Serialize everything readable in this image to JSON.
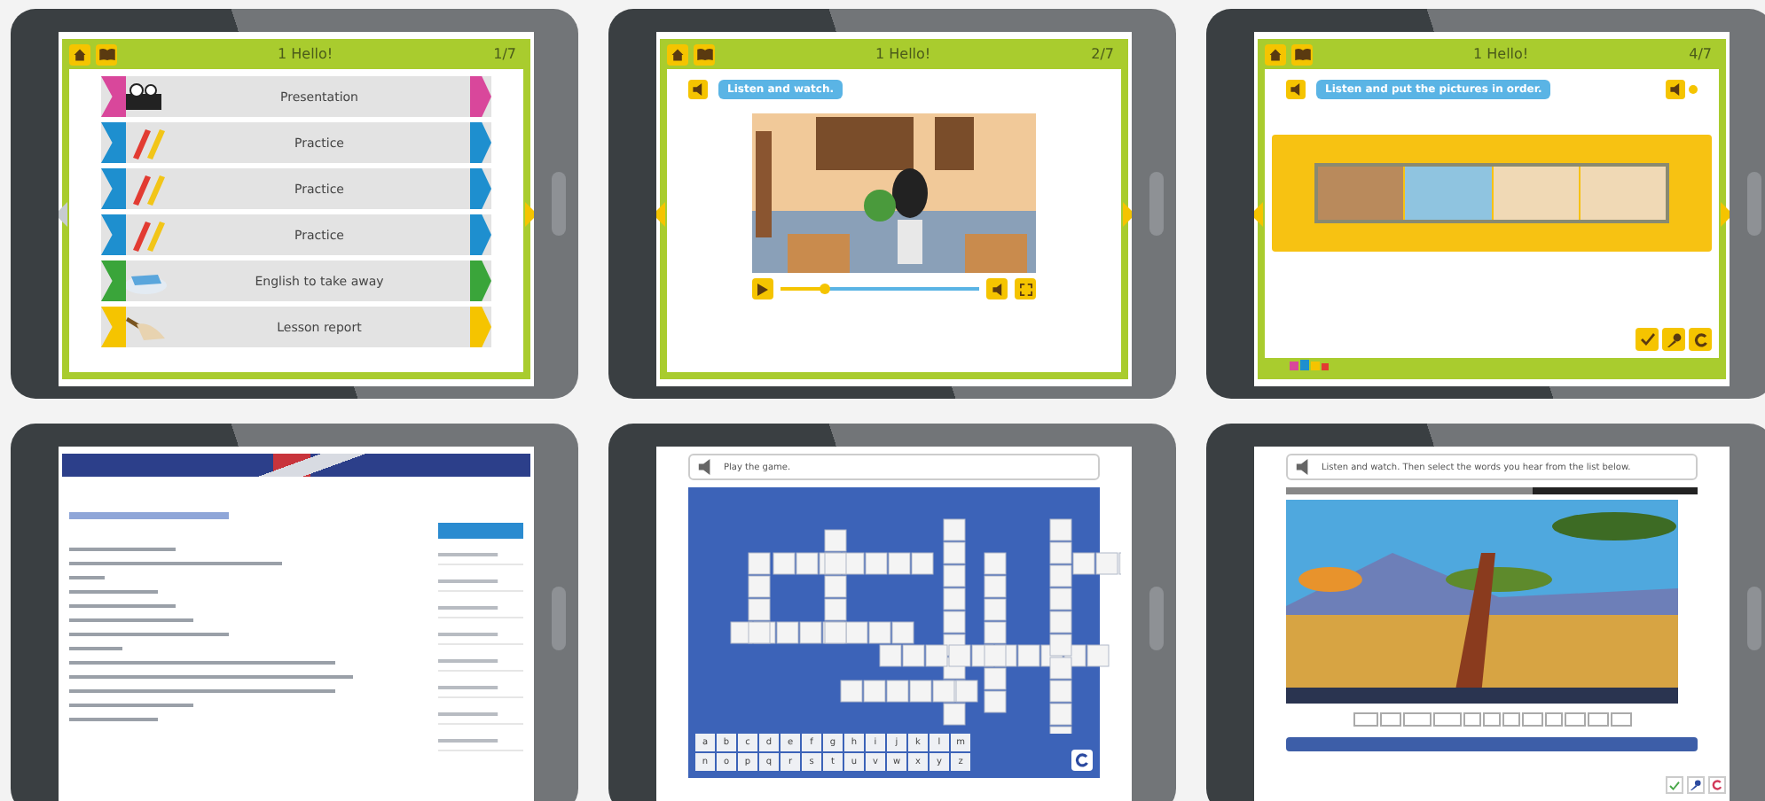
{
  "tablets": [
    {
      "kind": "menu",
      "header": {
        "title": "1 Hello!",
        "page": "1/7"
      },
      "prev_disabled": true,
      "items": [
        {
          "label": "Presentation",
          "kind": "presentation",
          "color": "#d9479b"
        },
        {
          "label": "Practice",
          "kind": "practice",
          "color": "#1e8fcf"
        },
        {
          "label": "Practice",
          "kind": "practice",
          "color": "#1e8fcf"
        },
        {
          "label": "Practice",
          "kind": "practice",
          "color": "#1e8fcf"
        },
        {
          "label": "English to take away",
          "kind": "takeaway",
          "color": "#3aa53a"
        },
        {
          "label": "Lesson report",
          "kind": "report",
          "color": "#f5c400"
        }
      ]
    },
    {
      "kind": "video",
      "header": {
        "title": "1 Hello!",
        "page": "2/7"
      },
      "prev_disabled": false,
      "instruction": "Listen and watch.",
      "player": {
        "level": 0.22
      }
    },
    {
      "kind": "ordering",
      "header": {
        "title": "1 Hello!",
        "page": "4/7"
      },
      "prev_disabled": false,
      "instruction": "Listen and put the pictures in order.",
      "pictures": [
        {
          "kind": "door"
        },
        {
          "kind": "window"
        },
        {
          "kind": "desk"
        },
        {
          "kind": "desk"
        }
      ]
    },
    {
      "kind": "webpage"
    },
    {
      "kind": "crossword",
      "instruction": "Play the game.",
      "keyboard": [
        [
          "a",
          "b",
          "c",
          "d",
          "e",
          "f",
          "g",
          "h",
          "i",
          "j",
          "k",
          "l",
          "m"
        ],
        [
          "n",
          "o",
          "p",
          "q",
          "r",
          "s",
          "t",
          "u",
          "v",
          "w",
          "x",
          "y",
          "z"
        ]
      ]
    },
    {
      "kind": "video_quiz",
      "instruction": "Listen and watch. Then select the words you hear from the list below.",
      "progress": {
        "level": 0.6
      }
    }
  ]
}
